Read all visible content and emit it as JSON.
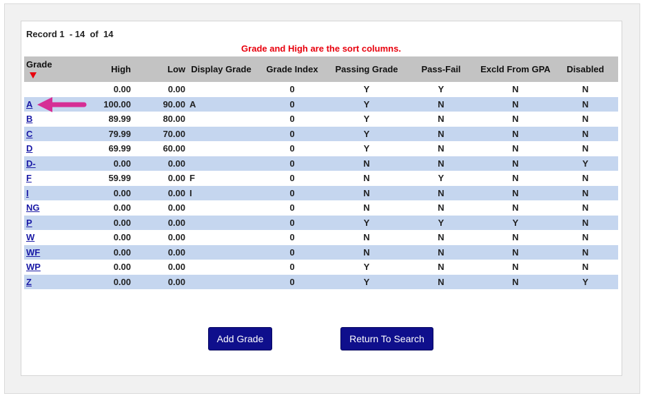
{
  "record_info": {
    "text": "Record 1  - 14  of  14"
  },
  "sort_note": "Grade and High are the sort columns.",
  "columns": [
    "Grade",
    "High",
    "Low",
    "Display Grade",
    "Grade Index",
    "Passing Grade",
    "Pass-Fail",
    "Excld From GPA",
    "Disabled"
  ],
  "rows": [
    {
      "grade": "",
      "high": "0.00",
      "low": "0.00",
      "display": "",
      "index": "0",
      "passing": "Y",
      "passfail": "Y",
      "excld": "N",
      "disabled": "N"
    },
    {
      "grade": "A",
      "high": "100.00",
      "low": "90.00",
      "display": "A",
      "index": "0",
      "passing": "Y",
      "passfail": "N",
      "excld": "N",
      "disabled": "N"
    },
    {
      "grade": "B",
      "high": "89.99",
      "low": "80.00",
      "display": "",
      "index": "0",
      "passing": "Y",
      "passfail": "N",
      "excld": "N",
      "disabled": "N"
    },
    {
      "grade": "C",
      "high": "79.99",
      "low": "70.00",
      "display": "",
      "index": "0",
      "passing": "Y",
      "passfail": "N",
      "excld": "N",
      "disabled": "N"
    },
    {
      "grade": "D",
      "high": "69.99",
      "low": "60.00",
      "display": "",
      "index": "0",
      "passing": "Y",
      "passfail": "N",
      "excld": "N",
      "disabled": "N"
    },
    {
      "grade": "D-",
      "high": "0.00",
      "low": "0.00",
      "display": "",
      "index": "0",
      "passing": "N",
      "passfail": "N",
      "excld": "N",
      "disabled": "Y"
    },
    {
      "grade": "F",
      "high": "59.99",
      "low": "0.00",
      "display": "F",
      "index": "0",
      "passing": "N",
      "passfail": "Y",
      "excld": "N",
      "disabled": "N"
    },
    {
      "grade": "I",
      "high": "0.00",
      "low": "0.00",
      "display": "I",
      "index": "0",
      "passing": "N",
      "passfail": "N",
      "excld": "N",
      "disabled": "N"
    },
    {
      "grade": "NG",
      "high": "0.00",
      "low": "0.00",
      "display": "",
      "index": "0",
      "passing": "N",
      "passfail": "N",
      "excld": "N",
      "disabled": "N"
    },
    {
      "grade": "P",
      "high": "0.00",
      "low": "0.00",
      "display": "",
      "index": "0",
      "passing": "Y",
      "passfail": "Y",
      "excld": "Y",
      "disabled": "N"
    },
    {
      "grade": "W",
      "high": "0.00",
      "low": "0.00",
      "display": "",
      "index": "0",
      "passing": "N",
      "passfail": "N",
      "excld": "N",
      "disabled": "N"
    },
    {
      "grade": "WF",
      "high": "0.00",
      "low": "0.00",
      "display": "",
      "index": "0",
      "passing": "N",
      "passfail": "N",
      "excld": "N",
      "disabled": "N"
    },
    {
      "grade": "WP",
      "high": "0.00",
      "low": "0.00",
      "display": "",
      "index": "0",
      "passing": "Y",
      "passfail": "N",
      "excld": "N",
      "disabled": "N"
    },
    {
      "grade": "Z",
      "high": "0.00",
      "low": "0.00",
      "display": "",
      "index": "0",
      "passing": "Y",
      "passfail": "N",
      "excld": "N",
      "disabled": "Y"
    }
  ],
  "buttons": {
    "add_grade": "Add Grade",
    "return_to_search": "Return To Search"
  },
  "icons": {
    "sort": "sort-descending-icon",
    "pointer": "pointer-arrow-icon"
  },
  "colors": {
    "sort_note": "#e8000d",
    "header_bg": "#c3c3c3",
    "alt_row_bg": "#c5d6ef",
    "button_bg": "#0f0f8c",
    "link": "#1a1aa6",
    "arrow": "#d62e95"
  }
}
